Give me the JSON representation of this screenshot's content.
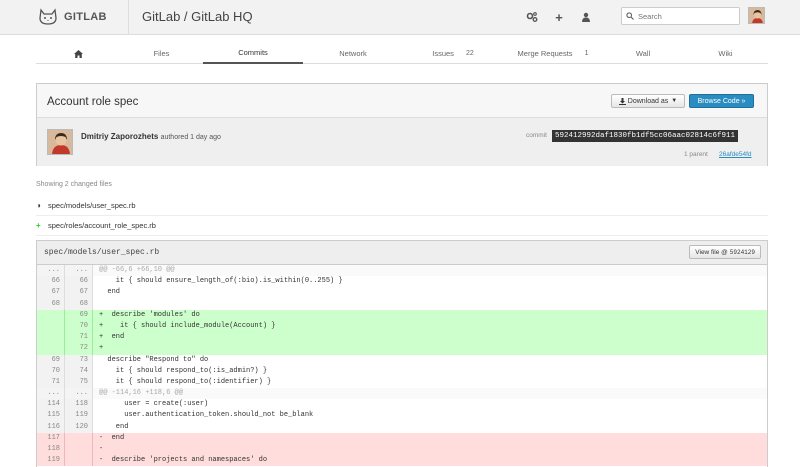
{
  "header": {
    "logo_text": "GITLAB",
    "project_title": "GitLab / GitLab HQ",
    "search_placeholder": "Search"
  },
  "nav": {
    "tabs": [
      {
        "label": "",
        "icon": "home-icon"
      },
      {
        "label": "Files"
      },
      {
        "label": "Commits",
        "active": true
      },
      {
        "label": "Network"
      },
      {
        "label": "Issues",
        "count": "22"
      },
      {
        "label": "Merge Requests",
        "count": "1"
      },
      {
        "label": "Wall"
      },
      {
        "label": "Wiki"
      }
    ]
  },
  "commit": {
    "title": "Account role spec",
    "download_label": "Download as",
    "browse_label": "Browse Code »",
    "author": "Dmitriy Zaporozhets",
    "authored": "authored 1 day ago",
    "commit_label": "commit",
    "sha": "592412992daf1830fb1df5cc06aac02814c6f911",
    "parent_label": "1 parent",
    "parent_sha": "26afde54fd"
  },
  "files": {
    "summary": "Showing 2 changed files",
    "list": [
      {
        "name": "spec/models/user_spec.rb",
        "status": "modified"
      },
      {
        "name": "spec/roles/account_role_spec.rb",
        "status": "added"
      }
    ]
  },
  "diff": {
    "file": "spec/models/user_spec.rb",
    "view_label": "View file @",
    "view_sha": "5924129",
    "lines": [
      {
        "type": "hunk",
        "old": "...",
        "new": "...",
        "code": "@@ -66,6 +66,10 @@"
      },
      {
        "type": "ctx",
        "old": "66",
        "new": "66",
        "code": "    it { should ensure_length_of(:bio).is_within(0..255) }"
      },
      {
        "type": "ctx",
        "old": "67",
        "new": "67",
        "code": "  end"
      },
      {
        "type": "ctx",
        "old": "68",
        "new": "68",
        "code": ""
      },
      {
        "type": "add",
        "old": "",
        "new": "69",
        "code": "+  describe 'modules' do"
      },
      {
        "type": "add",
        "old": "",
        "new": "70",
        "code": "+    it { should include_module(Account) }"
      },
      {
        "type": "add",
        "old": "",
        "new": "71",
        "code": "+  end"
      },
      {
        "type": "add",
        "old": "",
        "new": "72",
        "code": "+"
      },
      {
        "type": "ctx",
        "old": "69",
        "new": "73",
        "code": "  describe \"Respond to\" do"
      },
      {
        "type": "ctx",
        "old": "70",
        "new": "74",
        "code": "    it { should respond_to(:is_admin?) }"
      },
      {
        "type": "ctx",
        "old": "71",
        "new": "75",
        "code": "    it { should respond_to(:identifier) }"
      },
      {
        "type": "hunk",
        "old": "...",
        "new": "...",
        "code": "@@ -114,16 +118,6 @@"
      },
      {
        "type": "ctx",
        "old": "114",
        "new": "118",
        "code": "      user = create(:user)"
      },
      {
        "type": "ctx",
        "old": "115",
        "new": "119",
        "code": "      user.authentication_token.should_not be_blank"
      },
      {
        "type": "ctx",
        "old": "116",
        "new": "120",
        "code": "    end"
      },
      {
        "type": "del",
        "old": "117",
        "new": "",
        "code": "-  end"
      },
      {
        "type": "del",
        "old": "118",
        "new": "",
        "code": "-"
      },
      {
        "type": "del",
        "old": "119",
        "new": "",
        "code": "-  describe 'projects and namespaces' do"
      }
    ]
  }
}
